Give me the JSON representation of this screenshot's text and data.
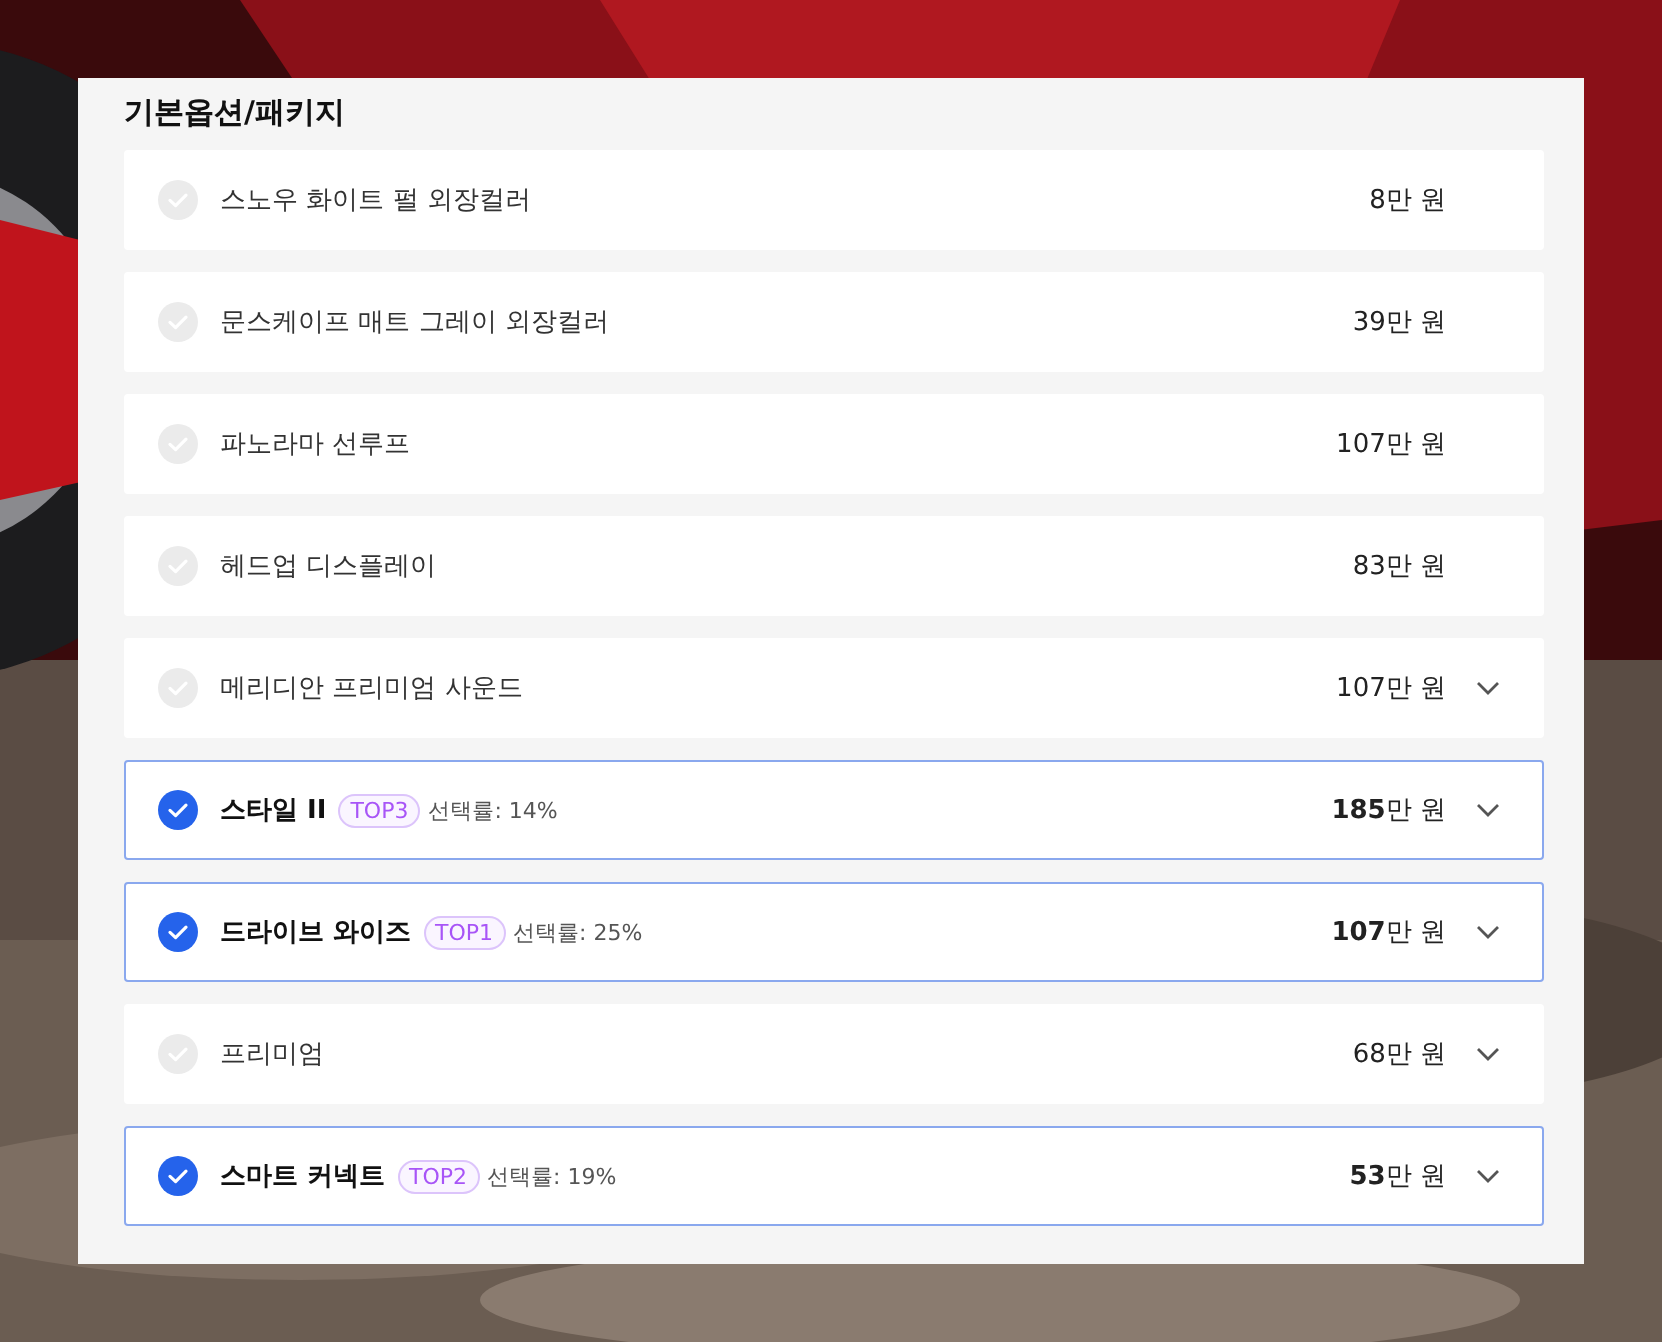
{
  "section": {
    "title": "기본옵션/패키지",
    "options": [
      {
        "name": "스노우 화이트 펄 외장컬러",
        "price": "8만 원",
        "selected": false,
        "expandable": false
      },
      {
        "name": "문스케이프 매트 그레이 외장컬러",
        "price": "39만 원",
        "selected": false,
        "expandable": false
      },
      {
        "name": "파노라마 선루프",
        "price": "107만 원",
        "selected": false,
        "expandable": false
      },
      {
        "name": "헤드업 디스플레이",
        "price": "83만 원",
        "selected": false,
        "expandable": false
      },
      {
        "name": "메리디안 프리미엄 사운드",
        "price": "107만 원",
        "selected": false,
        "expandable": true
      },
      {
        "name": "스타일 II",
        "badge": "TOP3",
        "rate": "선택률: 14%",
        "price": "**185**만 원",
        "selected": true,
        "expandable": true
      },
      {
        "name": "드라이브 와이즈",
        "badge": "TOP1",
        "rate": "선택률: 25%",
        "price": "**107**만 원",
        "selected": true,
        "expandable": true
      },
      {
        "name": "프리미엄",
        "price": "68만 원",
        "selected": false,
        "expandable": true
      },
      {
        "name": "스마트 커넥트",
        "badge": "TOP2",
        "rate": "선택률: 19%",
        "price": "**53**만 원",
        "selected": true,
        "expandable": true
      }
    ]
  }
}
